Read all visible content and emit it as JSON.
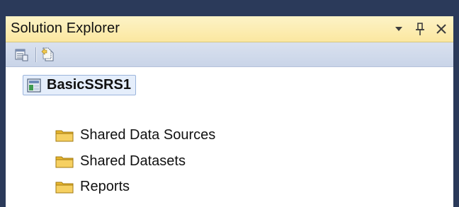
{
  "panel": {
    "title": "Solution Explorer",
    "controls": [
      {
        "name": "dropdown-arrow-icon"
      },
      {
        "name": "pin-icon"
      },
      {
        "name": "close-icon"
      }
    ]
  },
  "toolbar": {
    "buttons": [
      {
        "name": "properties-button",
        "icon": "properties-icon"
      },
      {
        "name": "show-all-files-button",
        "icon": "show-all-files-icon"
      }
    ]
  },
  "tree": {
    "root": {
      "label": "BasicSSRS1",
      "icon": "project-icon"
    },
    "items": [
      {
        "label": "Shared Data Sources",
        "icon": "folder-icon"
      },
      {
        "label": "Shared Datasets",
        "icon": "folder-icon"
      },
      {
        "label": "Reports",
        "icon": "folder-icon"
      }
    ]
  },
  "colors": {
    "title_bar": "#fbe7a0",
    "toolbar": "#c9d4e8",
    "frame": "#2b3a5a",
    "folder": "#f2c94c"
  }
}
